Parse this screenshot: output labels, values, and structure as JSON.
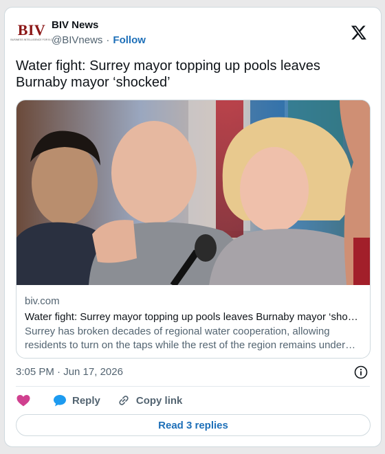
{
  "author": {
    "logo_text": "BIV",
    "logo_tagline": "BUSINESS INTELLIGENCE FOR B.C.",
    "name": "BIV News",
    "handle": "@BIVnews",
    "separator": "·",
    "follow_label": "Follow"
  },
  "tweet": {
    "text": "Water fight: Surrey mayor topping up pools leaves Burnaby mayor ‘shocked’",
    "timestamp": "3:05 PM · Jun 17, 2026"
  },
  "link_card": {
    "domain": "biv.com",
    "title": "Water fight: Surrey mayor topping up pools leaves Burnaby mayor ‘shocked’",
    "description": "Surrey has broken decades of regional water cooperation, allowing residents to turn on the taps while the rest of the region remains under restrictions."
  },
  "actions": {
    "like_icon": "heart-icon",
    "reply_label": "Reply",
    "copy_link_label": "Copy link"
  },
  "replies_button": "Read 3 replies",
  "colors": {
    "accent": "#1d6fb8",
    "like": "#d0408f",
    "reply_icon": "#1d9bf0",
    "text_secondary": "#536471",
    "border": "#cfd9de"
  }
}
